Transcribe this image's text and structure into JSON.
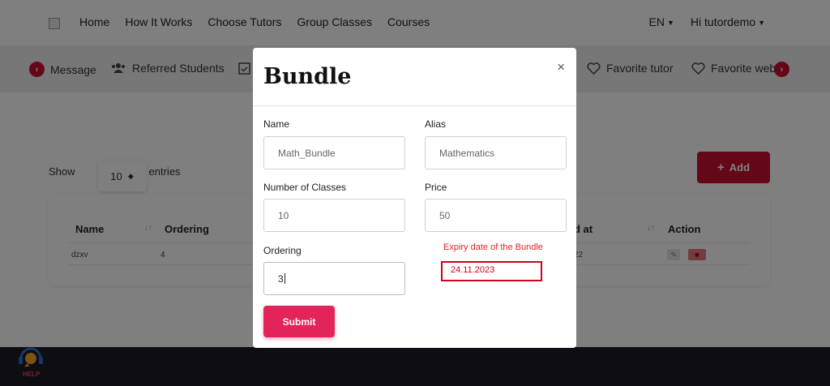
{
  "navbar": {
    "links": [
      "Home",
      "How It Works",
      "Choose Tutors",
      "Group Classes",
      "Courses"
    ],
    "language": "EN",
    "greeting": "Hi tutordemo"
  },
  "subnav": {
    "items": [
      "Message",
      "Referred Students",
      "Favorite tutor",
      "Favorite web"
    ]
  },
  "listing": {
    "show_label": "Show",
    "entries_value": "10",
    "entries_label": "entries",
    "add_label": "Add"
  },
  "table": {
    "headers": [
      "Name",
      "Ordering",
      "d at",
      "Action"
    ],
    "rows": [
      {
        "name": "dzxv",
        "ordering": "4",
        "date": "22"
      }
    ]
  },
  "help": {
    "label": "HELP"
  },
  "modal": {
    "title": "Bundle",
    "close_symbol": "×",
    "fields": {
      "name": {
        "label": "Name",
        "value": "Math_Bundle"
      },
      "alias": {
        "label": "Alias",
        "value": "Mathematics"
      },
      "classes": {
        "label": "Number of Classes",
        "value": "10"
      },
      "price": {
        "label": "Price",
        "value": "50"
      },
      "ordering": {
        "label": "Ordering",
        "value": "3"
      }
    },
    "expiry": {
      "label": "Expiry date of the Bundle",
      "value": "24.11.2023"
    },
    "submit_label": "Submit"
  },
  "colors": {
    "brand": "#c8102e",
    "submit": "#e2245a",
    "annotation": "#d0021b",
    "footer": "#1b1b24"
  }
}
